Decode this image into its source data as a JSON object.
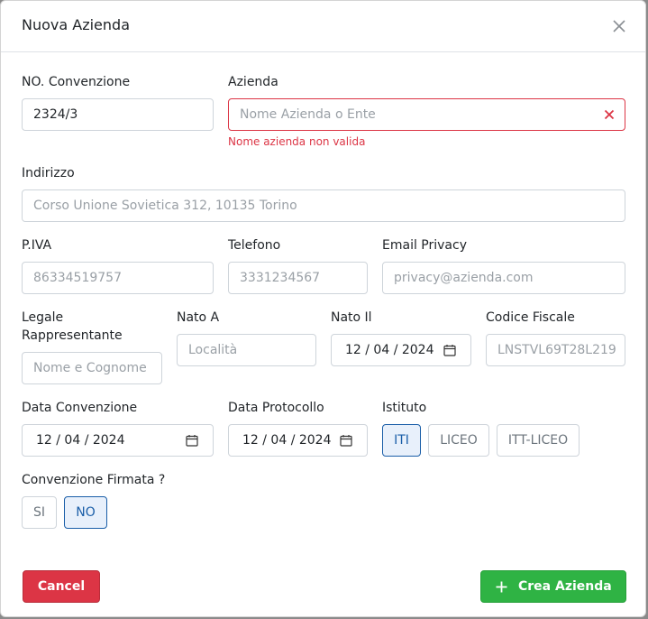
{
  "modal": {
    "title": "Nuova Azienda"
  },
  "fields": {
    "convenzione": {
      "label": "NO. Convenzione",
      "value": "2324/3"
    },
    "azienda": {
      "label": "Azienda",
      "placeholder": "Nome Azienda o Ente",
      "error": "Nome azienda non valida"
    },
    "indirizzo": {
      "label": "Indirizzo",
      "placeholder": "Corso Unione Sovietica 312, 10135 Torino"
    },
    "piva": {
      "label": "P.IVA",
      "placeholder": "86334519757"
    },
    "telefono": {
      "label": "Telefono",
      "placeholder": "3331234567"
    },
    "email_privacy": {
      "label": "Email Privacy",
      "placeholder": "privacy@azienda.com"
    },
    "legale_rappresentante": {
      "label_line1": "Legale",
      "label_line2": "Rappresentante",
      "placeholder": "Nome e Cognome"
    },
    "nato_a": {
      "label": "Nato A",
      "placeholder": "Località"
    },
    "nato_il": {
      "label": "Nato Il",
      "value": "12 / 04 / 2024"
    },
    "codice_fiscale": {
      "label": "Codice Fiscale",
      "placeholder": "LNSTVL69T28L219"
    },
    "data_convenzione": {
      "label": "Data Convenzione",
      "value": "12 / 04 / 2024"
    },
    "data_protocollo": {
      "label": "Data Protocollo",
      "value": "12 / 04 / 2024"
    }
  },
  "istituto": {
    "label": "Istituto",
    "options": [
      "ITI",
      "LICEO",
      "ITT-LICEO"
    ],
    "selected": "ITI"
  },
  "firmata": {
    "label": "Convenzione Firmata ?",
    "options": [
      "SI",
      "NO"
    ],
    "selected": "NO"
  },
  "buttons": {
    "cancel": "Cancel",
    "create": "Crea Azienda"
  },
  "colors": {
    "danger": "#dc3545",
    "success": "#2fb344",
    "primary": "#1a5ea8"
  }
}
